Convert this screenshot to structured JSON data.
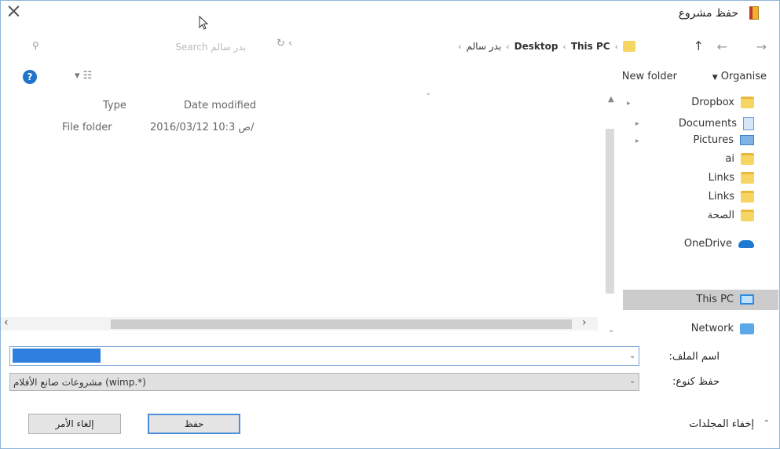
{
  "window": {
    "title": "حفظ مشروع"
  },
  "address": {
    "breadcrumbs": [
      "This PC",
      "Desktop",
      "بدر سالم"
    ],
    "search_placeholder": "Search بدر سالم"
  },
  "toolbar": {
    "organise": "Organise",
    "new_folder": "New folder",
    "help": "?"
  },
  "file_list": {
    "columns": [
      "Type",
      "Date modified"
    ],
    "rows": [
      {
        "type": "File folder",
        "date": "2016/03/12 ص 10:3/"
      }
    ]
  },
  "nav_pane": {
    "items": [
      {
        "label": "Dropbox",
        "icon": "folder-icon"
      },
      {
        "label": "Documents",
        "icon": "documents-icon"
      },
      {
        "label": "Pictures",
        "icon": "pictures-icon"
      },
      {
        "label": "ai",
        "icon": "folder-icon"
      },
      {
        "label": "Links",
        "icon": "folder-icon"
      },
      {
        "label": "Links",
        "icon": "folder-icon"
      },
      {
        "label": "الصحة",
        "icon": "folder-icon"
      },
      {
        "label": "OneDrive",
        "icon": "onedrive-icon"
      },
      {
        "label": "This PC",
        "icon": "this-pc-icon",
        "selected": true
      },
      {
        "label": "Network",
        "icon": "network-icon"
      }
    ]
  },
  "form": {
    "filename_label": "اسم الملف:",
    "filename_value": "",
    "filetype_label": "حفظ كنوع:",
    "filetype_value": "(*.wimp) مشروعات صانع الأفلام"
  },
  "buttons": {
    "save": "حفظ",
    "cancel": "إلغاء الأمر"
  },
  "footer": {
    "hide_folders": "إخفاء المجلدات"
  },
  "colors": {
    "accent": "#2f7fde",
    "selection": "#cccccc",
    "border": "#8db4d8"
  }
}
